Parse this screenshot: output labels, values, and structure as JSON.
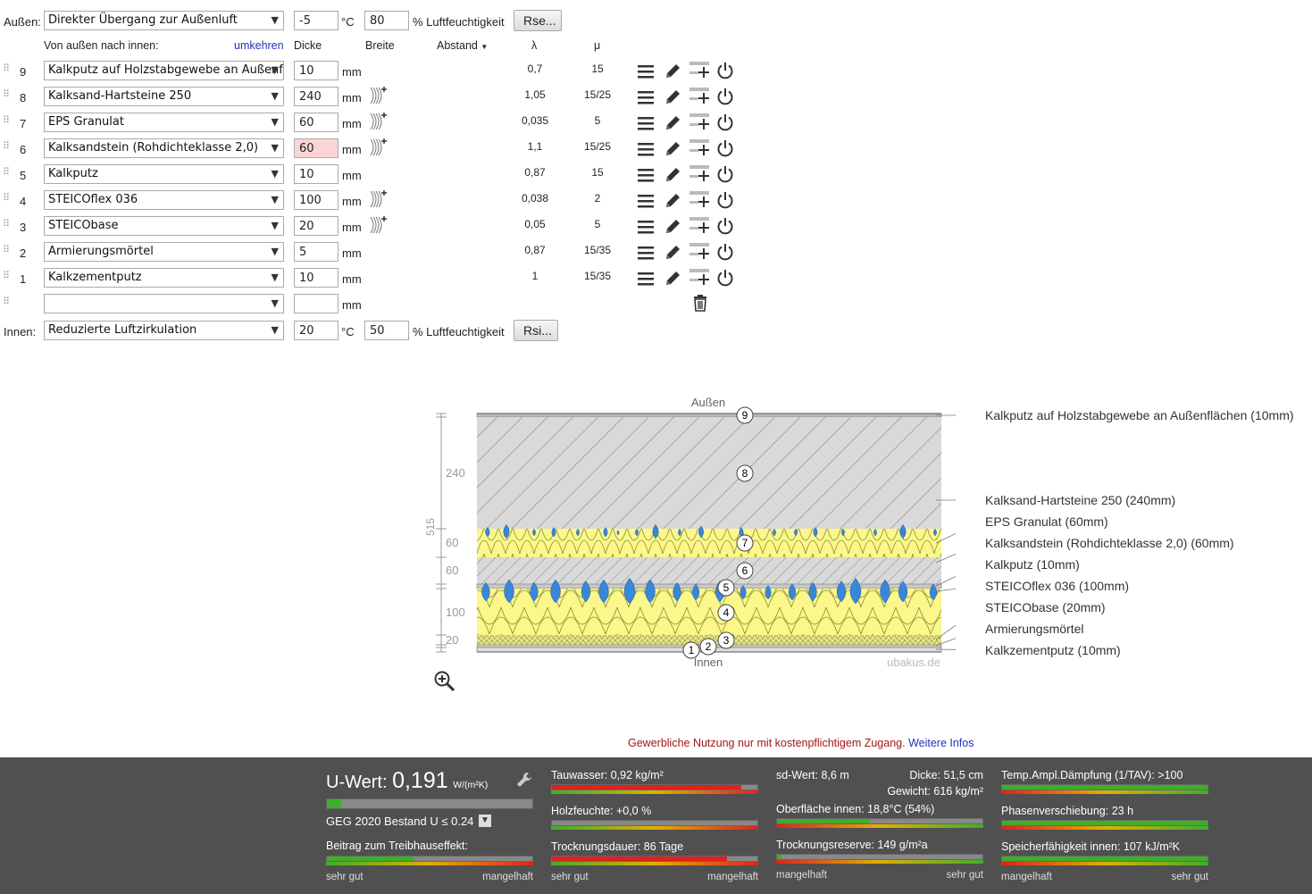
{
  "outside": {
    "label": "Außen:",
    "transition": "Direkter Übergang zur Außenluft",
    "temp": "-5",
    "temp_unit": "°C",
    "humidity": "80",
    "humidity_label": "% Luftfeuchtigkeit",
    "button": "Rse..."
  },
  "header": {
    "direction": "Von außen nach innen:",
    "reverse_link": "umkehren",
    "col_thickness": "Dicke",
    "col_width": "Breite",
    "col_distance": "Abstand",
    "col_lambda": "λ",
    "col_mu": "μ"
  },
  "layers": [
    {
      "no": "9",
      "name": "Kalkputz auf Holzstabgewebe an Außenflächen",
      "thickness": "10",
      "unit": "mm",
      "lambda": "0,7",
      "mu": "15",
      "hatch": false,
      "error": false
    },
    {
      "no": "8",
      "name": "Kalksand-Hartsteine 250",
      "thickness": "240",
      "unit": "mm",
      "lambda": "1,05",
      "mu": "15/25",
      "hatch": true,
      "error": false
    },
    {
      "no": "7",
      "name": "EPS Granulat",
      "thickness": "60",
      "unit": "mm",
      "lambda": "0,035",
      "mu": "5",
      "hatch": true,
      "error": false
    },
    {
      "no": "6",
      "name": "Kalksandstein (Rohdichteklasse 2,0)",
      "thickness": "60",
      "unit": "mm",
      "lambda": "1,1",
      "mu": "15/25",
      "hatch": true,
      "error": true
    },
    {
      "no": "5",
      "name": "Kalkputz",
      "thickness": "10",
      "unit": "mm",
      "lambda": "0,87",
      "mu": "15",
      "hatch": false,
      "error": false
    },
    {
      "no": "4",
      "name": "STEICOflex 036",
      "thickness": "100",
      "unit": "mm",
      "lambda": "0,038",
      "mu": "2",
      "hatch": true,
      "error": false
    },
    {
      "no": "3",
      "name": "STEICObase",
      "thickness": "20",
      "unit": "mm",
      "lambda": "0,05",
      "mu": "5",
      "hatch": true,
      "error": false
    },
    {
      "no": "2",
      "name": "Armierungsmörtel",
      "thickness": "5",
      "unit": "mm",
      "lambda": "0,87",
      "mu": "15/35",
      "hatch": false,
      "error": false
    },
    {
      "no": "1",
      "name": "Kalkzementputz",
      "thickness": "10",
      "unit": "mm",
      "lambda": "1",
      "mu": "15/35",
      "hatch": false,
      "error": false
    }
  ],
  "empty_row": {
    "unit": "mm"
  },
  "inside": {
    "label": "Innen:",
    "transition": "Reduzierte Luftzirkulation",
    "temp": "20",
    "temp_unit": "°C",
    "humidity": "50",
    "humidity_label": "% Luftfeuchtigkeit",
    "button": "Rsi..."
  },
  "diagram": {
    "top_label": "Außen",
    "bottom_label": "Innen",
    "watermark": "ubakus.de",
    "total": "515",
    "dims": [
      "240",
      "60",
      "60",
      "100",
      "20"
    ],
    "legend": [
      "Kalkputz auf Holzstabgewebe an Außenflächen (10mm)",
      "Kalksand-Hartsteine 250 (240mm)",
      "EPS Granulat (60mm)",
      "Kalksandstein (Rohdichteklasse 2,0) (60mm)",
      "Kalkputz (10mm)",
      "STEICOflex 036 (100mm)",
      "STEICObase (20mm)",
      "Armierungsmörtel",
      "Kalkzementputz (10mm)"
    ]
  },
  "notice": {
    "text": "Gewerbliche Nutzung nur mit kostenpflichtigem Zugang.",
    "link": "Weitere Infos"
  },
  "results": {
    "uwert_label": "U-Wert:",
    "uwert_value": "0,191",
    "uwert_unit": "W/(m²K)",
    "uwert_fill": 0.07,
    "geg": "GEG 2020 Bestand U ≤ 0.24",
    "treibhaus": "Beitrag zum Treibhauseffekt:",
    "treibhaus_fill": 0.42,
    "tauwasser": "Tauwasser: 0,92 kg/m²",
    "tauwasser_fill": 0.92,
    "holzfeuchte": "Holzfeuchte: +0,0 %",
    "holzfeuchte_fill": 0.0,
    "trocknungsdauer": "Trocknungsdauer: 86 Tage",
    "trocknungsdauer_fill": 0.85,
    "sd": "sd-Wert: 8,6 m",
    "dicke": "Dicke: 51,5 cm",
    "gewicht": "Gewicht: 616 kg/m²",
    "oberflaeche": "Oberfläche innen: 18,8°C (54%)",
    "oberflaeche_fill": 0.45,
    "trocknungsreserve": "Trocknungsreserve: 149 g/m²a",
    "trocknungsreserve_fill": 0.02,
    "tav": "Temp.Ampl.Dämpfung (1/TAV): >100",
    "tav_fill": 1.0,
    "phase": "Phasenverschiebung: 23 h",
    "phase_fill": 1.0,
    "speicher": "Speicherfähigkeit innen: 107 kJ/m²K",
    "speicher_fill": 1.0,
    "scale_good": "sehr gut",
    "scale_bad": "mangelhaft",
    "colors": {
      "good": "#3fae2a",
      "bad": "#d22",
      "warn": "#e0b000"
    }
  }
}
